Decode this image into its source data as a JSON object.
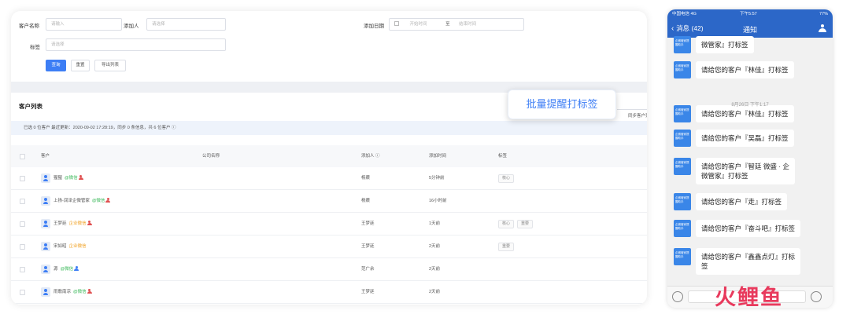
{
  "filters": {
    "customer_name_label": "客户名称",
    "customer_name_placeholder": "请输入",
    "added_by_label": "添加人",
    "added_by_placeholder": "请选择",
    "added_date_label": "添加日期",
    "start_placeholder": "开始时间",
    "date_sep": "至",
    "end_placeholder": "结束时间",
    "tag_label": "标签",
    "tag_placeholder": "请选择",
    "query_button": "查询",
    "reset_button": "重置",
    "export_button": "导出列表"
  },
  "list": {
    "title": "客户列表",
    "popup_button": "批量提醒打标签",
    "sync_button": "同步客户列表",
    "info": "已选 0 位客户      最近更新：2020-09-02 17:28:19，同步 0 条信息，共 6 位客户  ⓘ",
    "headers": {
      "customer": "客户",
      "company": "公司名称",
      "added_by": "添加人 ⓘ",
      "added_time": "添加时间",
      "tags": "标签"
    },
    "rows": [
      {
        "name": "猩猩",
        "suffix": "@微信",
        "suffix_type": "green",
        "pin": "red",
        "added_by": "杨蕨",
        "time": "5分钟前",
        "tags": [
          "核心"
        ]
      },
      {
        "name": "上扬-润泽企微管家",
        "suffix": "@微信",
        "suffix_type": "green",
        "pin": "red",
        "added_by": "杨蕨",
        "time": "16小时前",
        "tags": []
      },
      {
        "name": "王梦廷",
        "suffix": "企业微信",
        "suffix_type": "orange",
        "pin": "red",
        "added_by": "王梦廷",
        "time": "1天前",
        "tags": [
          "核心",
          "重要"
        ]
      },
      {
        "name": "宋如昭",
        "suffix": "企业微信",
        "suffix_type": "orange",
        "pin": "",
        "added_by": "王梦廷",
        "time": "2天前",
        "tags": [
          "重要"
        ]
      },
      {
        "name": "源",
        "suffix": "@微信",
        "suffix_type": "green",
        "pin": "blue",
        "added_by": "范广余",
        "time": "2天前",
        "tags": []
      },
      {
        "name": "雨歌南凉",
        "suffix": "@微信",
        "suffix_type": "green",
        "pin": "red",
        "added_by": "王梦廷",
        "time": "2天前",
        "tags": []
      }
    ]
  },
  "phone": {
    "carrier": "中国电信 4G",
    "clock": "下午5:57",
    "battery": "77%",
    "back_label": "消息 (42)",
    "title": "通知",
    "person_icon": "person-icon",
    "avatar_text": "企微管家提醒助手",
    "time_divider": "8月26日 下午1:17",
    "messages": [
      {
        "l1": "微管家』打标签",
        "l2": ""
      },
      {
        "l1": "请给您的客户『林佳』打标签",
        "l2": ""
      },
      {
        "l1": "请给您的客户『林佳』打标签",
        "l2": ""
      },
      {
        "l1": "请给您的客户『吴磊』打标签",
        "l2": ""
      },
      {
        "l1": "请给您的客户『智廷 微盛 · 企",
        "l2": "微管家』打标签"
      },
      {
        "l1": "请给您的客户『走』打标签",
        "l2": ""
      },
      {
        "l1": "请给您的客户『奋斗吧』打标签",
        "l2": ""
      },
      {
        "l1": "请给您的客户『鑫鑫点灯』打标",
        "l2": "签"
      }
    ]
  },
  "watermark": "火鲤鱼",
  "colors": {
    "primary": "#3d7ef5",
    "phone_bar": "#2c67c8",
    "wechat_green": "#3cb95b",
    "work_orange": "#f0a020"
  }
}
